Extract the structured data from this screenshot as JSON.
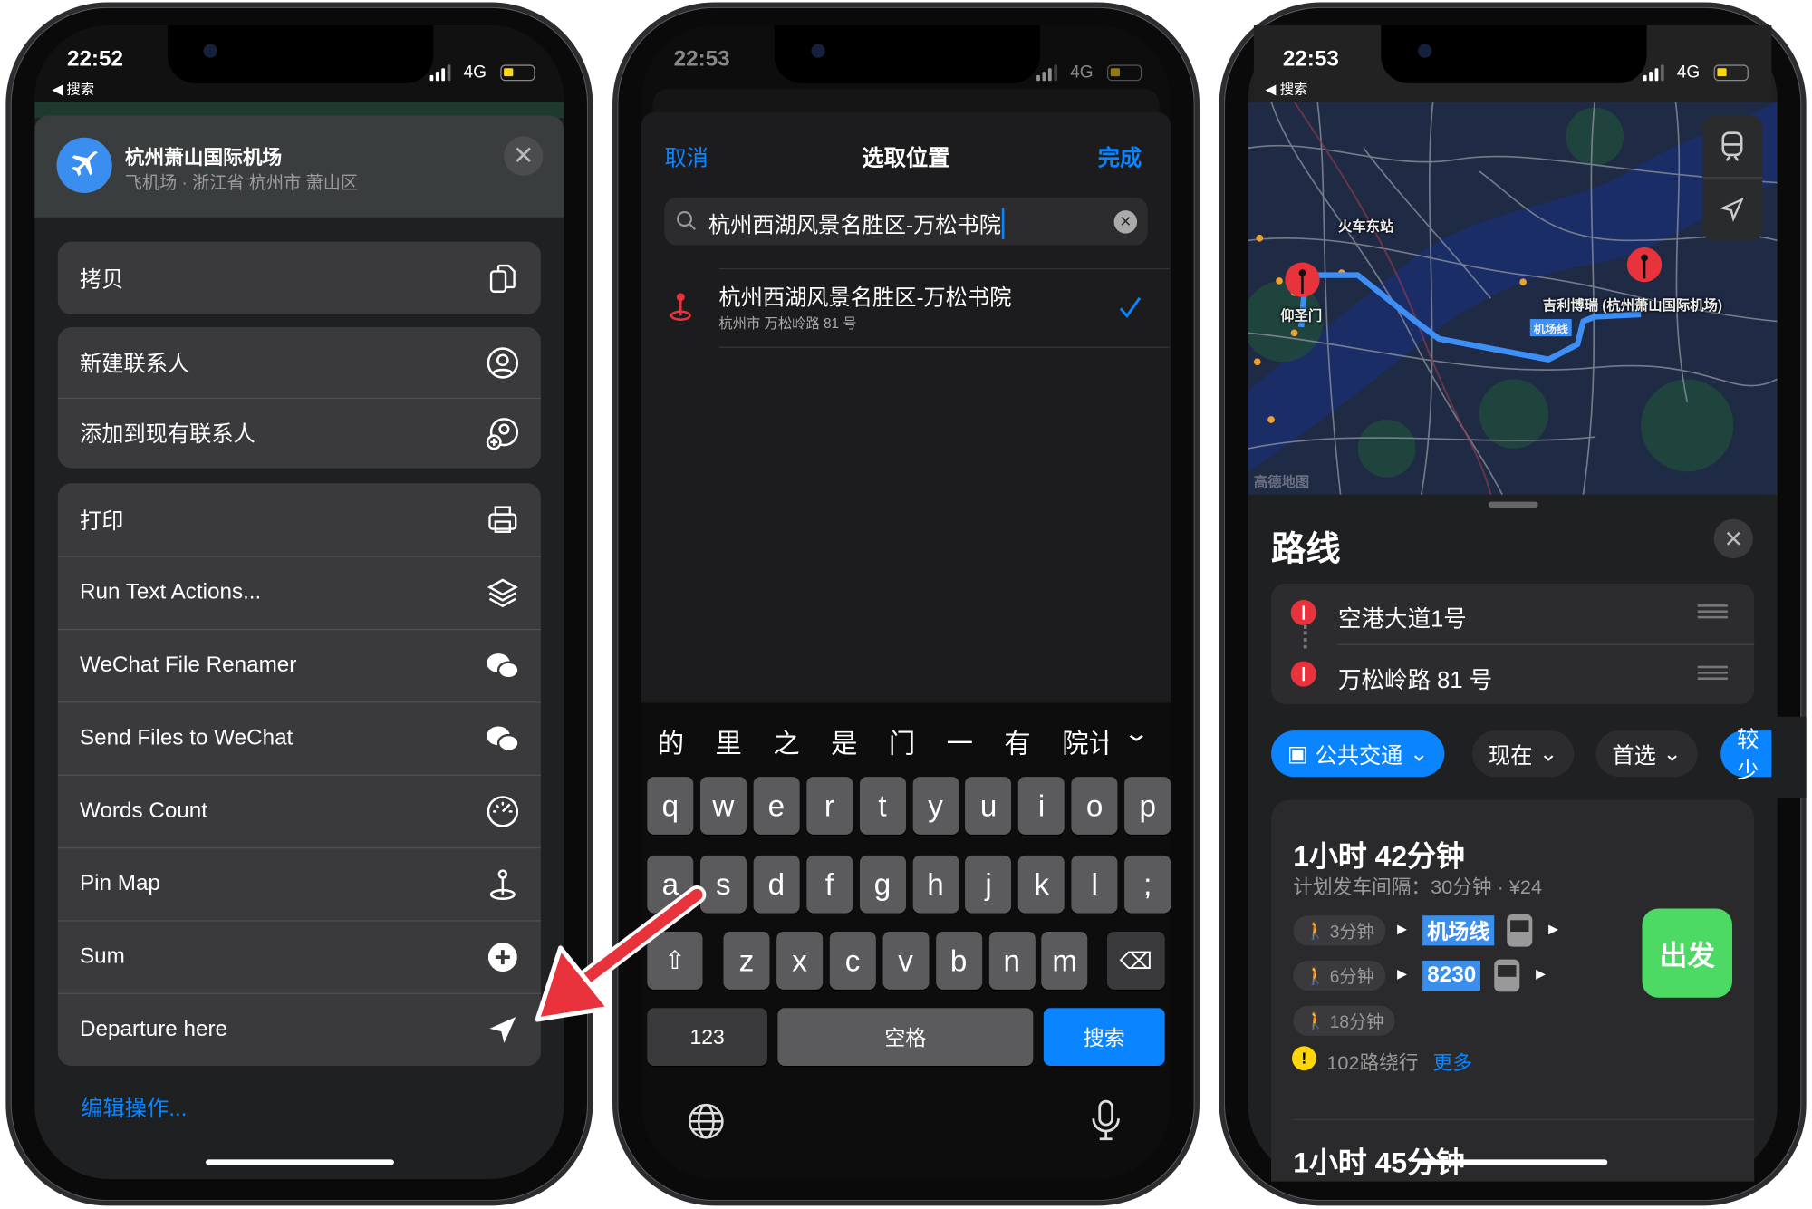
{
  "colors": {
    "accent": "#0a84ff",
    "go": "#4cd964",
    "transit_badge": "#3b8eea",
    "pin": "#e8323c",
    "warning": "#ffd60a"
  },
  "status": {
    "left_time": "22:52",
    "mid_time": "22:53",
    "right_time": "22:53",
    "back_label": "◀ 搜索",
    "network": "4G"
  },
  "share_sheet": {
    "place_title": "杭州萧山国际机场",
    "place_subtitle": "飞机场 · 浙江省 杭州市 萧山区",
    "place_icon": "airplane-icon",
    "actions": [
      {
        "label": "拷贝",
        "icon": "copy-icon"
      },
      {
        "label": "新建联系人",
        "icon": "person-circle-icon"
      },
      {
        "label": "添加到现有联系人",
        "icon": "person-add-icon"
      },
      {
        "label": "打印",
        "icon": "printer-icon"
      },
      {
        "label": "Run Text Actions...",
        "icon": "layers-icon"
      },
      {
        "label": "WeChat File Renamer",
        "icon": "wechat-icon"
      },
      {
        "label": "Send Files to WeChat",
        "icon": "wechat-icon"
      },
      {
        "label": "Words Count",
        "icon": "gauge-icon"
      },
      {
        "label": "Pin Map",
        "icon": "pin-map-icon"
      },
      {
        "label": "Sum",
        "icon": "plus-circle-icon"
      },
      {
        "label": "Departure here",
        "icon": "location-arrow-icon"
      }
    ],
    "edit_actions": "编辑操作..."
  },
  "picker": {
    "cancel": "取消",
    "title": "选取位置",
    "done": "完成",
    "search_value": "杭州西湖风景名胜区-万松书院",
    "result_title": "杭州西湖风景名胜区-万松书院",
    "result_subtitle": "杭州市 万松岭路 81 号",
    "candidates": [
      "的",
      "里",
      "之",
      "是",
      "门",
      "一",
      "有",
      "院计"
    ],
    "keys_row1": [
      "q",
      "w",
      "e",
      "r",
      "t",
      "y",
      "u",
      "i",
      "o",
      "p"
    ],
    "keys_row2": [
      "a",
      "s",
      "d",
      "f",
      "g",
      "h",
      "j",
      "k",
      "l",
      ";"
    ],
    "keys_row3": [
      "z",
      "x",
      "c",
      "v",
      "b",
      "n",
      "m"
    ],
    "key_123": "123",
    "key_space": "空格",
    "key_search": "搜索"
  },
  "maps": {
    "map_labels": {
      "station": "火车东站",
      "origin": "仰圣门",
      "destination": "吉利博瑞 (杭州萧山国际机场)",
      "line": "机场线",
      "provider": "高德地图"
    },
    "title": "路线",
    "waypoints": [
      "空港大道1号",
      "万松岭路 81 号"
    ],
    "chips": [
      {
        "label": "公共交通",
        "active": true
      },
      {
        "label": "现在"
      },
      {
        "label": "首选"
      },
      {
        "label": "较少"
      }
    ],
    "route1": {
      "duration": "1小时 42分钟",
      "detail": "计划发车间隔：30分钟 · ¥24",
      "walks": [
        "3分钟",
        "6分钟",
        "18分钟"
      ],
      "lines": [
        "机场线",
        "8230"
      ],
      "go": "出发",
      "notice": "102路绕行",
      "more": "更多"
    },
    "route2": {
      "duration": "1小时 45分钟"
    }
  }
}
